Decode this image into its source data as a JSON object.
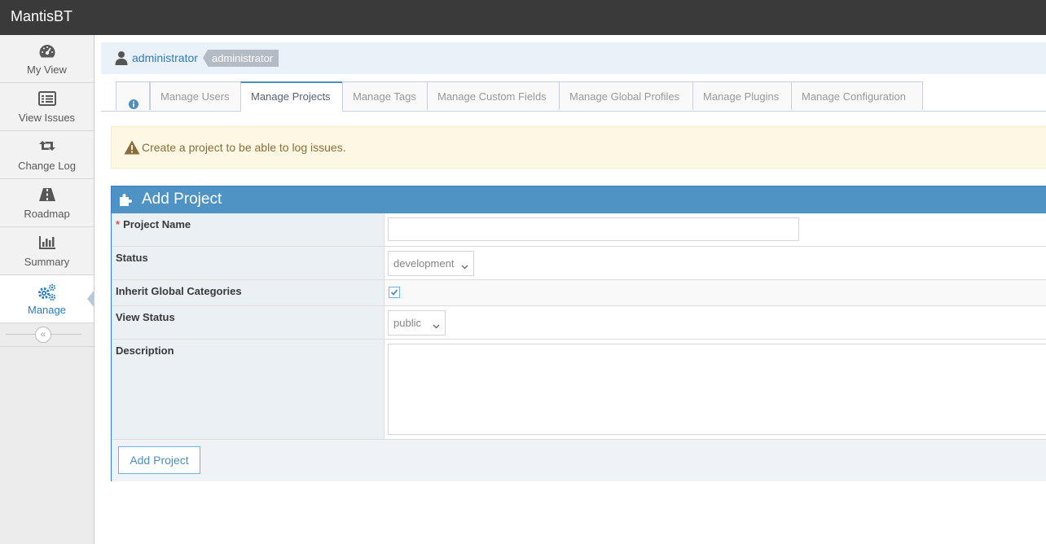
{
  "app": {
    "brand": "MantisBT"
  },
  "sidebar": {
    "items": [
      {
        "label": "My View",
        "icon": "dashboard-icon"
      },
      {
        "label": "View Issues",
        "icon": "list-alt-icon"
      },
      {
        "label": "Change Log",
        "icon": "retweet-icon"
      },
      {
        "label": "Roadmap",
        "icon": "road-icon"
      },
      {
        "label": "Summary",
        "icon": "bar-chart-icon"
      },
      {
        "label": "Manage",
        "icon": "gears-icon",
        "active": true
      }
    ],
    "collapse_glyph": "«"
  },
  "breadcrumb": {
    "user": "administrator",
    "role": "administrator"
  },
  "tabs": [
    {
      "label": "",
      "icon": "info-circle-icon"
    },
    {
      "label": "Manage Users"
    },
    {
      "label": "Manage Projects",
      "active": true
    },
    {
      "label": "Manage Tags"
    },
    {
      "label": "Manage Custom Fields"
    },
    {
      "label": "Manage Global Profiles"
    },
    {
      "label": "Manage Plugins"
    },
    {
      "label": "Manage Configuration"
    }
  ],
  "alert": {
    "text": "Create a project to be able to log issues."
  },
  "form": {
    "title": "Add Project",
    "required_marker": "*",
    "project_name": {
      "label": "Project Name",
      "value": ""
    },
    "status": {
      "label": "Status",
      "value": "development"
    },
    "inherit": {
      "label": "Inherit Global Categories",
      "checked": true
    },
    "view_status": {
      "label": "View Status",
      "value": "public"
    },
    "description": {
      "label": "Description",
      "value": ""
    },
    "submit_label": "Add Project"
  },
  "colors": {
    "navbar": "#3a3a3a",
    "widget_header": "#4f92c4",
    "link": "#337ab7",
    "alert_bg": "#fcf8e3",
    "alert_text": "#8a6d3b"
  }
}
